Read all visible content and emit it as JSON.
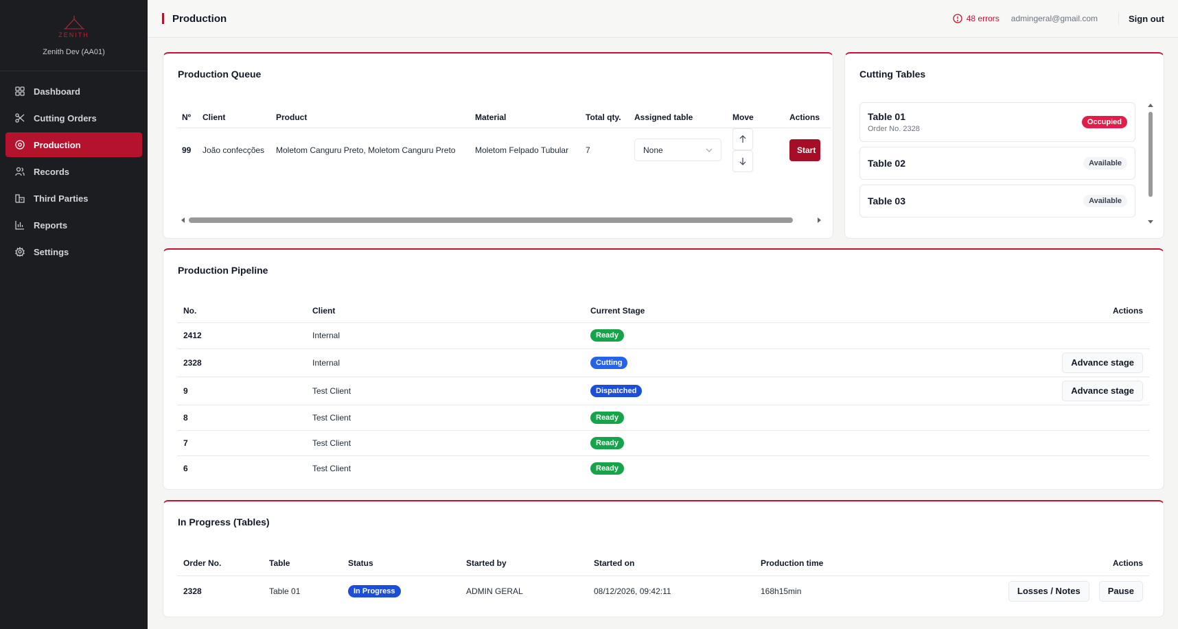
{
  "brand": {
    "logo_text": "ZENITH",
    "workspace": "Zenith Dev (AA01)"
  },
  "sidebar": {
    "items": [
      {
        "label": "Dashboard",
        "icon": "grid-icon"
      },
      {
        "label": "Cutting Orders",
        "icon": "scissors-icon"
      },
      {
        "label": "Production",
        "icon": "target-icon",
        "active": true
      },
      {
        "label": "Records",
        "icon": "users-icon"
      },
      {
        "label": "Third Parties",
        "icon": "building-icon"
      },
      {
        "label": "Reports",
        "icon": "bar-chart-icon"
      },
      {
        "label": "Settings",
        "icon": "gear-icon"
      }
    ]
  },
  "topbar": {
    "title": "Production",
    "errors": "48 errors",
    "email": "admingeral@gmail.com",
    "signout": "Sign out"
  },
  "colors": {
    "accent": "#b5122e",
    "ready": "#16a34a",
    "blue": "#1d4ed8",
    "occupied": "#e11d48"
  },
  "queue": {
    "title": "Production Queue",
    "headers": {
      "no": "Nº",
      "client": "Client",
      "product": "Product",
      "material": "Material",
      "qty": "Total qty.",
      "table": "Assigned table",
      "move": "Move",
      "actions": "Actions"
    },
    "rows": [
      {
        "no": "99",
        "client": "João confecções",
        "product": "Moletom Canguru Preto, Moletom Canguru Preto",
        "material": "Moletom Felpado Tubular",
        "qty": "7",
        "table": "None",
        "action": "Start"
      }
    ]
  },
  "cutting_tables": {
    "title": "Cutting Tables",
    "items": [
      {
        "name": "Table 01",
        "sub": "Order No. 2328",
        "status": "Occupied"
      },
      {
        "name": "Table 02",
        "sub": "",
        "status": "Available"
      },
      {
        "name": "Table 03",
        "sub": "",
        "status": "Available"
      }
    ]
  },
  "pipeline": {
    "title": "Production Pipeline",
    "headers": {
      "no": "No.",
      "client": "Client",
      "stage": "Current Stage",
      "actions": "Actions"
    },
    "rows": [
      {
        "no": "2412",
        "client": "Internal",
        "stage": "Ready",
        "stage_color": "#16a34a",
        "action": ""
      },
      {
        "no": "2328",
        "client": "Internal",
        "stage": "Cutting",
        "stage_color": "#2563eb",
        "action": "Advance stage"
      },
      {
        "no": "9",
        "client": "Test Client",
        "stage": "Dispatched",
        "stage_color": "#1d4ed8",
        "action": "Advance stage"
      },
      {
        "no": "8",
        "client": "Test Client",
        "stage": "Ready",
        "stage_color": "#16a34a",
        "action": ""
      },
      {
        "no": "7",
        "client": "Test Client",
        "stage": "Ready",
        "stage_color": "#16a34a",
        "action": ""
      },
      {
        "no": "6",
        "client": "Test Client",
        "stage": "Ready",
        "stage_color": "#16a34a",
        "action": ""
      }
    ]
  },
  "in_progress": {
    "title": "In Progress (Tables)",
    "headers": {
      "order": "Order No.",
      "table": "Table",
      "status": "Status",
      "started_by": "Started by",
      "started_on": "Started on",
      "time": "Production time",
      "actions": "Actions"
    },
    "rows": [
      {
        "order": "2328",
        "table": "Table 01",
        "status": "In Progress",
        "started_by": "ADMIN GERAL",
        "started_on": "08/12/2026, 09:42:11",
        "time": "168h15min",
        "action1": "Losses / Notes",
        "action2": "Pause"
      }
    ]
  }
}
